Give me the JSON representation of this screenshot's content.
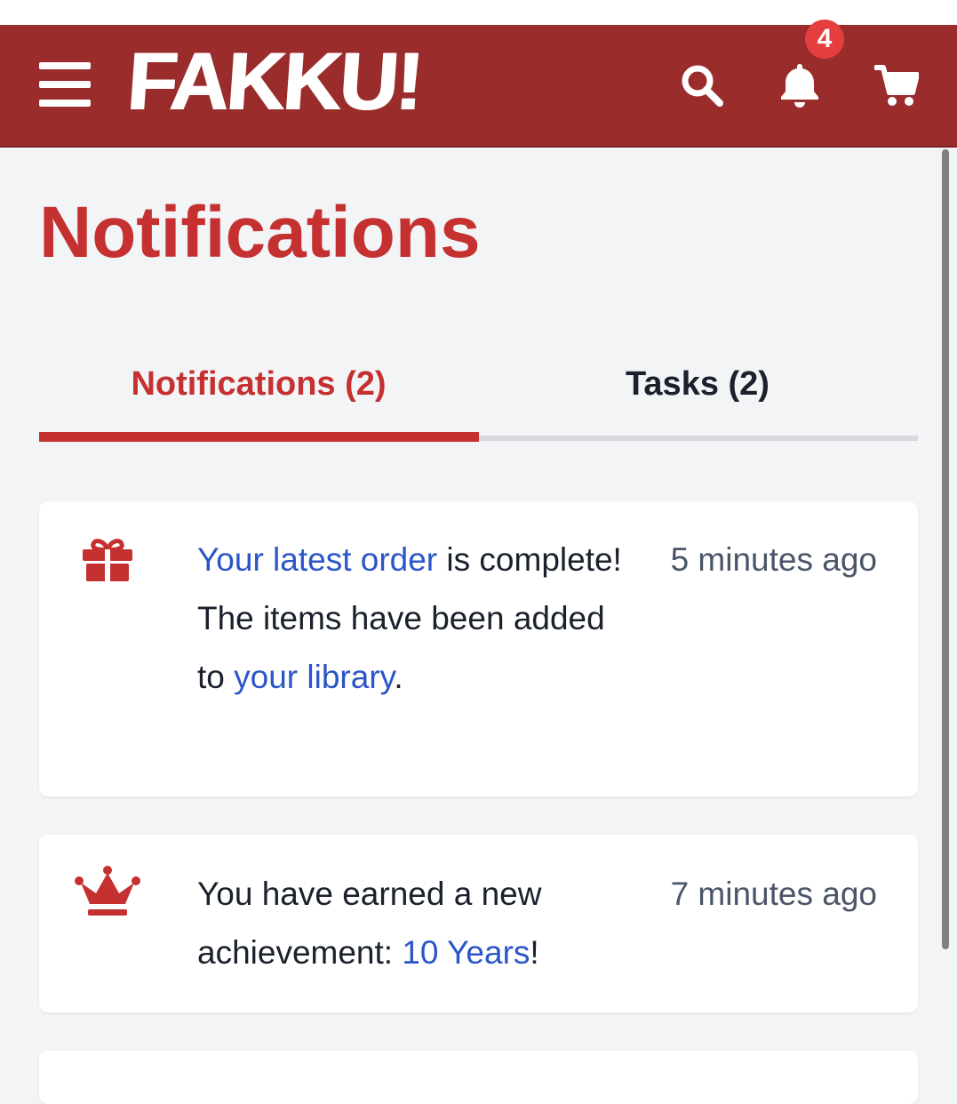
{
  "header": {
    "logo_text": "FAKKU!",
    "notification_count": "4",
    "brand_color": "#9b2c2c",
    "icons": [
      "menu-icon",
      "search-icon",
      "bell-icon",
      "cart-icon"
    ]
  },
  "page": {
    "title": "Notifications"
  },
  "tabs": [
    {
      "label": "Notifications (2)",
      "active": true
    },
    {
      "label": "Tasks (2)",
      "active": false
    }
  ],
  "notifications": [
    {
      "icon": "gift-icon",
      "link1": "Your latest order",
      "text1": " is complete! The items have been added to ",
      "link2": "your library",
      "text2": ".",
      "time": "5 minutes ago"
    },
    {
      "icon": "crown-icon",
      "text1": "You have earned a new achievement: ",
      "link1": "10 Years",
      "text2": "!",
      "time": "7 minutes ago"
    }
  ],
  "colors": {
    "accent": "#c53030",
    "link": "#2b55c8",
    "background": "#f3f4f6"
  }
}
